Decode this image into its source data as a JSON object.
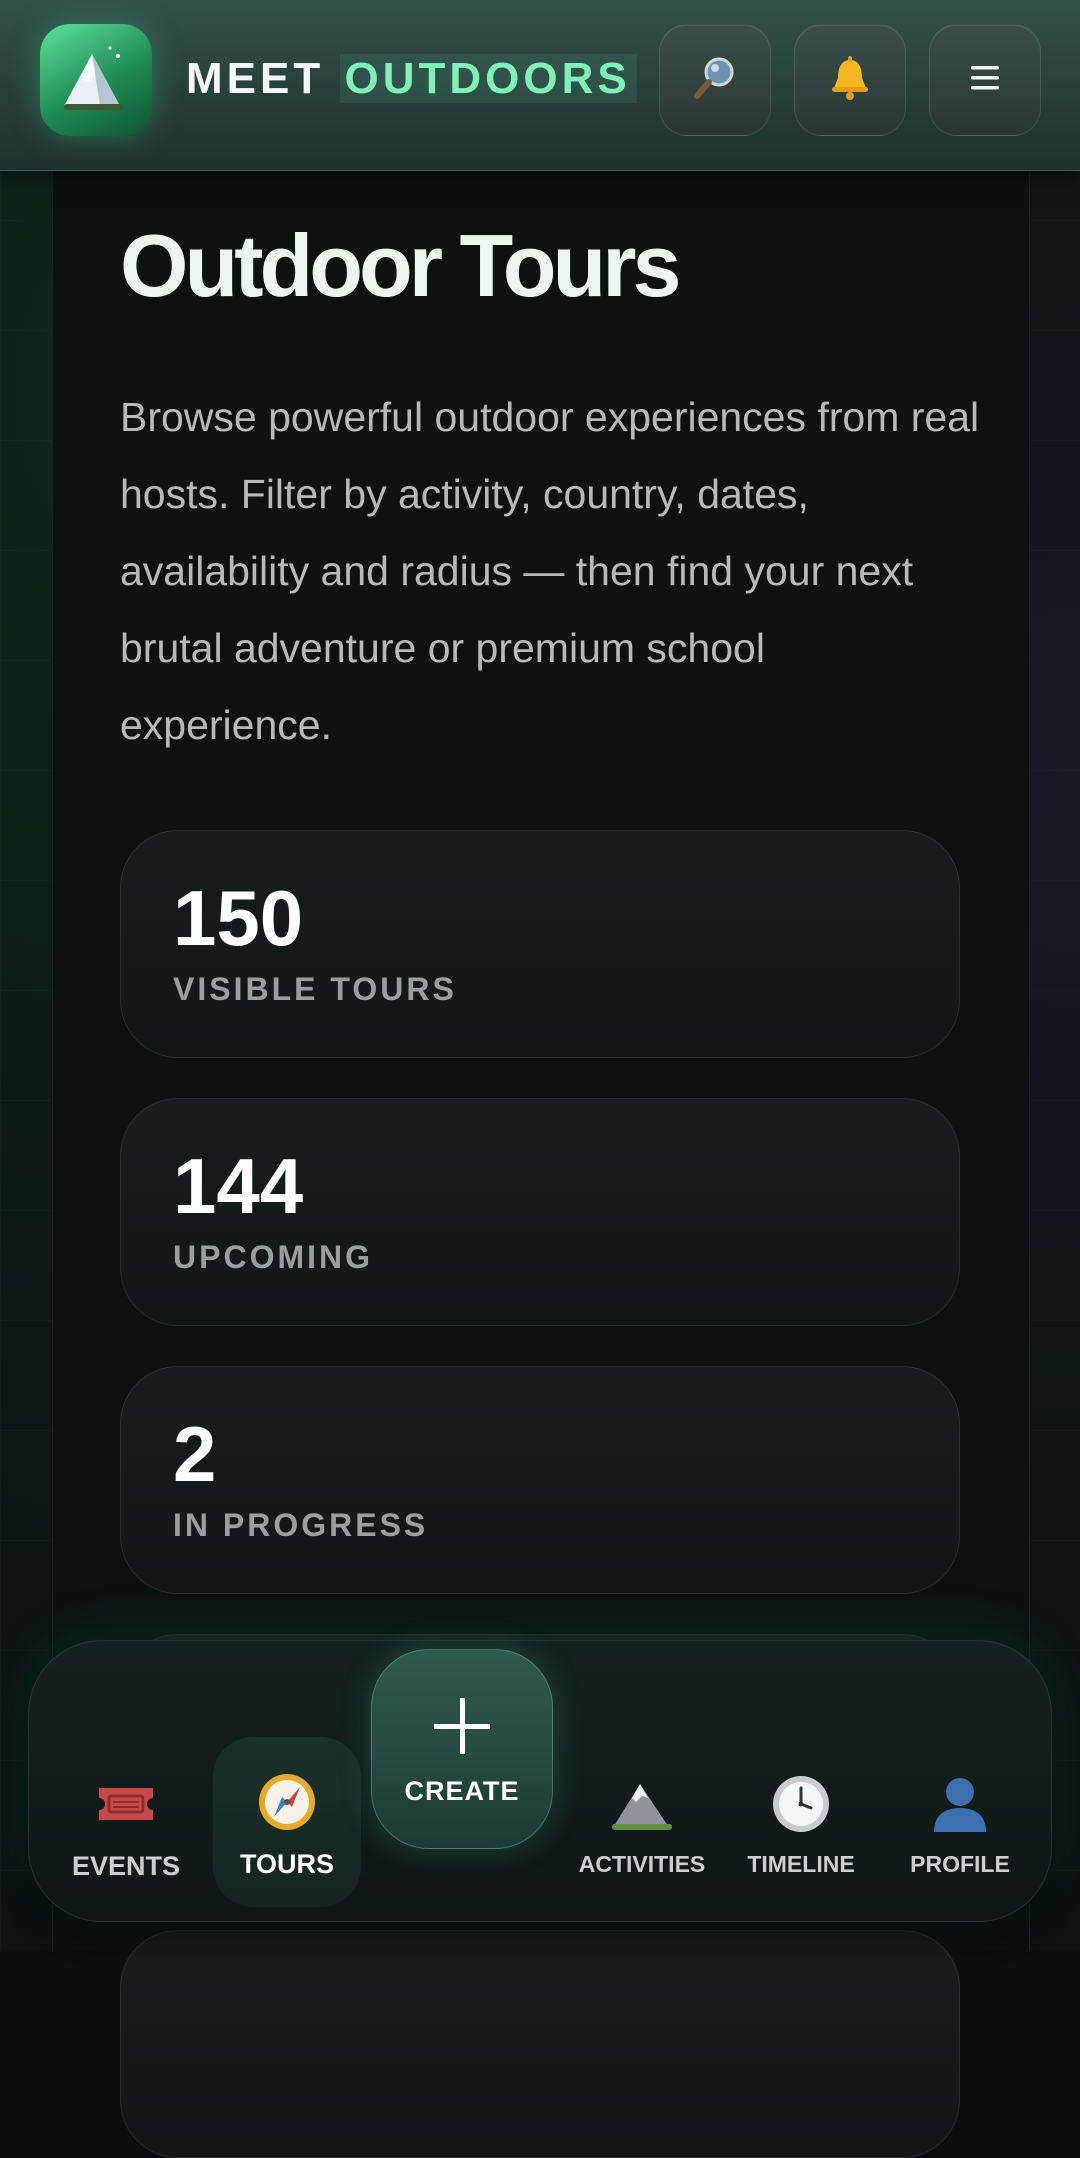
{
  "header": {
    "brand_primary": "MEET",
    "brand_accent": "OUTDOORS",
    "logo_icon": "mountain-logo-icon",
    "search_icon": "search-icon",
    "notifications_icon": "bell-icon",
    "menu_icon": "hamburger-menu-icon"
  },
  "main": {
    "title": "Outdoor Tours",
    "description": "Browse powerful outdoor experiences from real hosts. Filter by activity, country, dates, availability and radius — then find your next brutal adventure or premium school experience.",
    "stats": [
      {
        "value": "150",
        "label": "VISIBLE TOURS"
      },
      {
        "value": "144",
        "label": "UPCOMING"
      },
      {
        "value": "2",
        "label": "IN PROGRESS"
      }
    ]
  },
  "bottom_nav": {
    "items": [
      {
        "label": "EVENTS",
        "icon": "ticket-icon"
      },
      {
        "label": "TOURS",
        "icon": "compass-icon",
        "active": true
      },
      {
        "label": "CREATE",
        "icon": "plus-icon"
      },
      {
        "label": "ACTIVITIES",
        "icon": "mountain-icon"
      },
      {
        "label": "TIMELINE",
        "icon": "clock-icon"
      },
      {
        "label": "PROFILE",
        "icon": "user-icon"
      }
    ]
  },
  "colors": {
    "accent": "#7ef2b8",
    "background": "#0b1412",
    "header": "#2b423e",
    "card": "#151b1a"
  }
}
